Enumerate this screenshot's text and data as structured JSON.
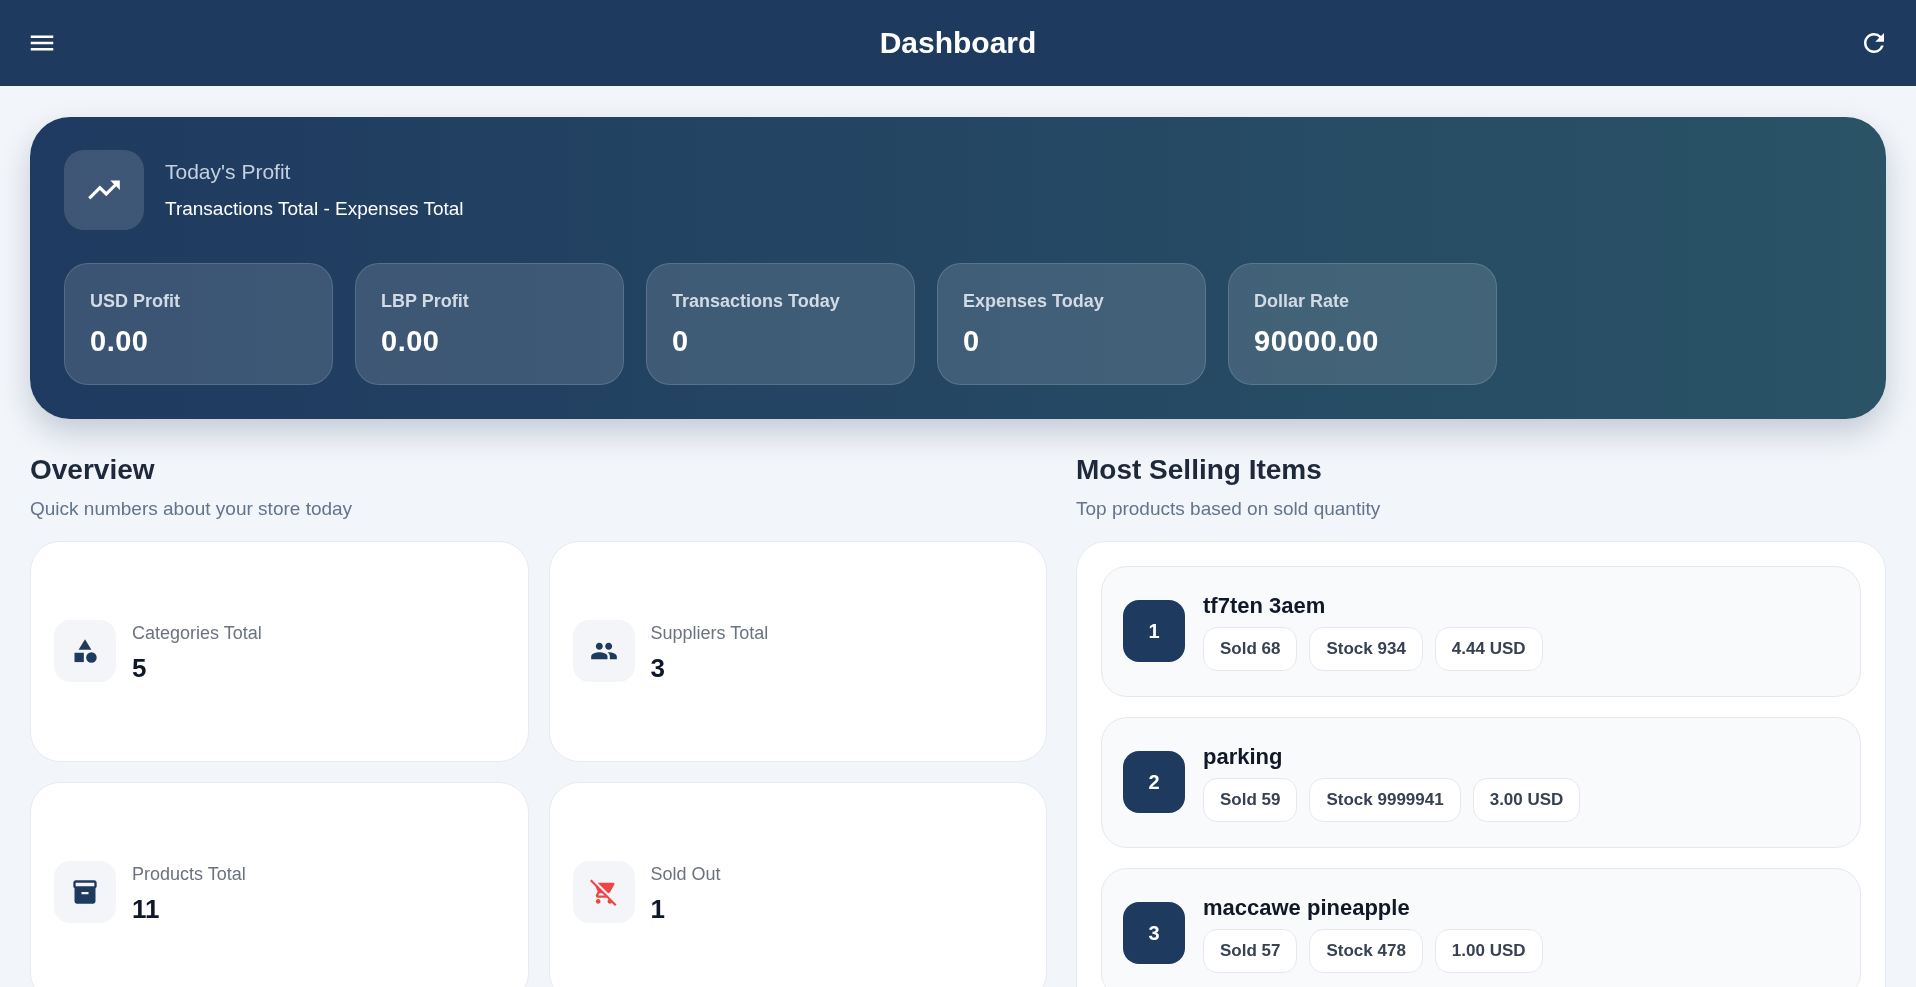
{
  "header": {
    "title": "Dashboard"
  },
  "profit_card": {
    "title": "Today's Profit",
    "subtitle": "Transactions Total - Expenses Total",
    "stats": [
      {
        "label": "USD Profit",
        "value": "0.00"
      },
      {
        "label": "LBP Profit",
        "value": "0.00"
      },
      {
        "label": "Transactions Today",
        "value": "0"
      },
      {
        "label": "Expenses Today",
        "value": "0"
      },
      {
        "label": "Dollar Rate",
        "value": "90000.00"
      }
    ]
  },
  "overview": {
    "title": "Overview",
    "subtitle": "Quick numbers about your store today",
    "cards": [
      {
        "kind": "categories",
        "label": "Categories Total",
        "value": "5"
      },
      {
        "kind": "suppliers",
        "label": "Suppliers Total",
        "value": "3"
      },
      {
        "kind": "products",
        "label": "Products Total",
        "value": "11"
      },
      {
        "kind": "sold_out",
        "label": "Sold Out",
        "value": "1"
      }
    ]
  },
  "most_selling": {
    "title": "Most Selling Items",
    "subtitle": "Top products based on sold quantity",
    "items": [
      {
        "rank": "1",
        "name": "tf7ten 3aem",
        "tags": [
          "Sold 68",
          "Stock 934",
          "4.44 USD"
        ]
      },
      {
        "rank": "2",
        "name": "parking",
        "tags": [
          "Sold 59",
          "Stock 9999941",
          "3.00 USD"
        ]
      },
      {
        "rank": "3",
        "name": "maccawe pineapple",
        "tags": [
          "Sold 57",
          "Stock 478",
          "1.00 USD"
        ]
      }
    ]
  }
}
